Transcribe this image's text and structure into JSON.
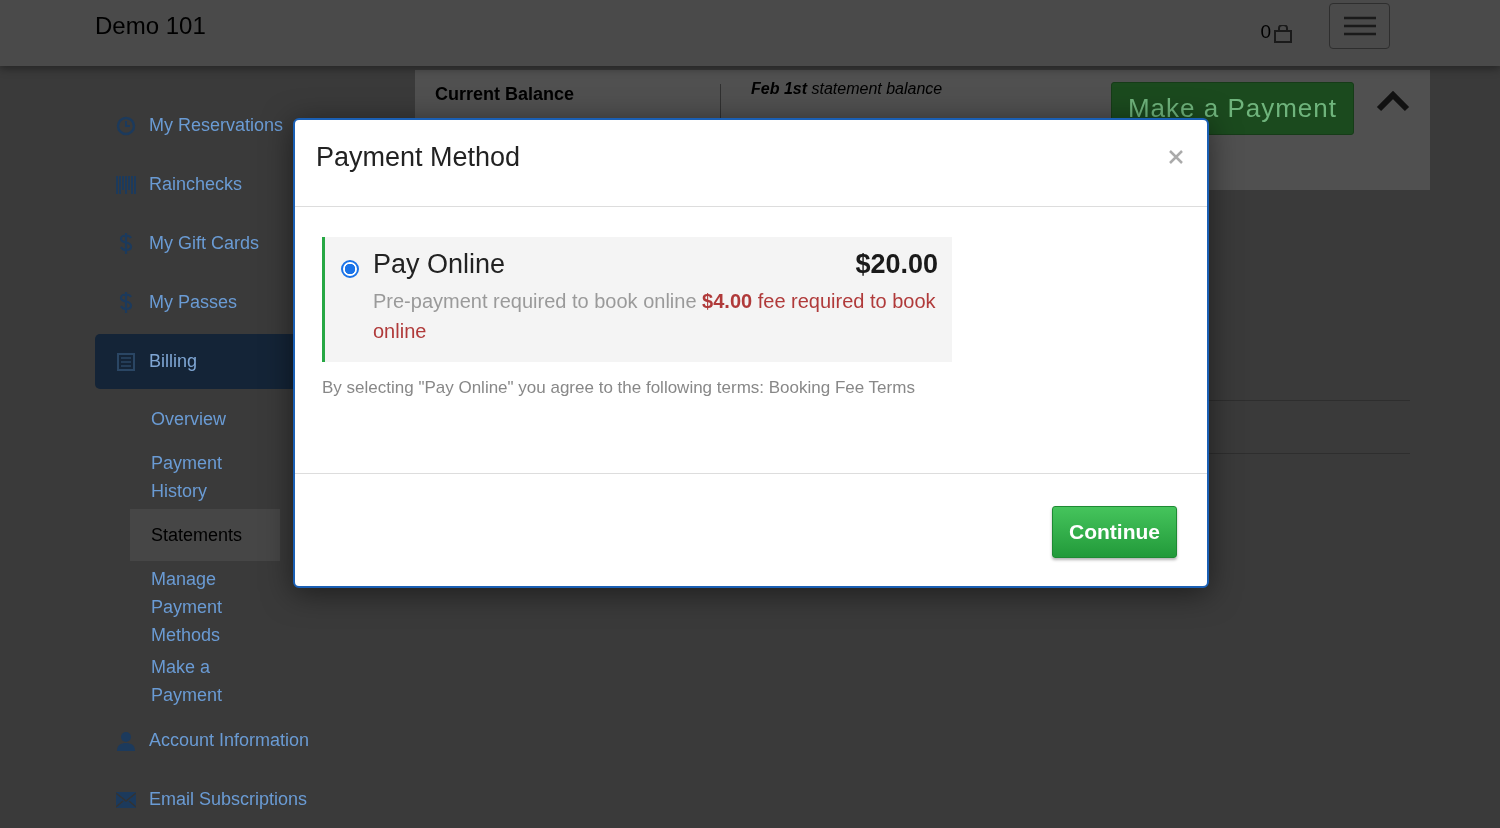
{
  "header": {
    "title": "Demo 101",
    "cart_count": "0"
  },
  "sidebar": {
    "items": [
      {
        "label": "My Reservations",
        "selected": false
      },
      {
        "label": "Rainchecks",
        "selected": false
      },
      {
        "label": "My Gift Cards",
        "selected": false
      },
      {
        "label": "My Passes",
        "selected": false
      },
      {
        "label": "Billing",
        "selected": true,
        "children": [
          {
            "label": "Overview",
            "selected": false
          },
          {
            "label": "Payment History",
            "selected": false
          },
          {
            "label": "Statements",
            "selected": true
          },
          {
            "label": "Manage Payment Methods",
            "selected": false
          },
          {
            "label": "Make a Payment",
            "selected": false
          }
        ]
      },
      {
        "label": "Account Information",
        "selected": false
      },
      {
        "label": "Email Subscriptions",
        "selected": false
      }
    ]
  },
  "balance": {
    "heading": "Current Balance",
    "statement": "**Feb 1st** statement balance",
    "button": "Make a Payment"
  },
  "modal": {
    "title": "Payment Method",
    "options": [
      {
        "label": "Pay Online",
        "amount": "$20.00",
        "description": "Pre-payment required to book online",
        "fee_note": "**$4.00** fee required to book online",
        "selected": true
      }
    ],
    "terms": "By selecting \"Pay Online\" you agree to the following terms: Booking Fee Terms",
    "button": "Continue"
  }
}
